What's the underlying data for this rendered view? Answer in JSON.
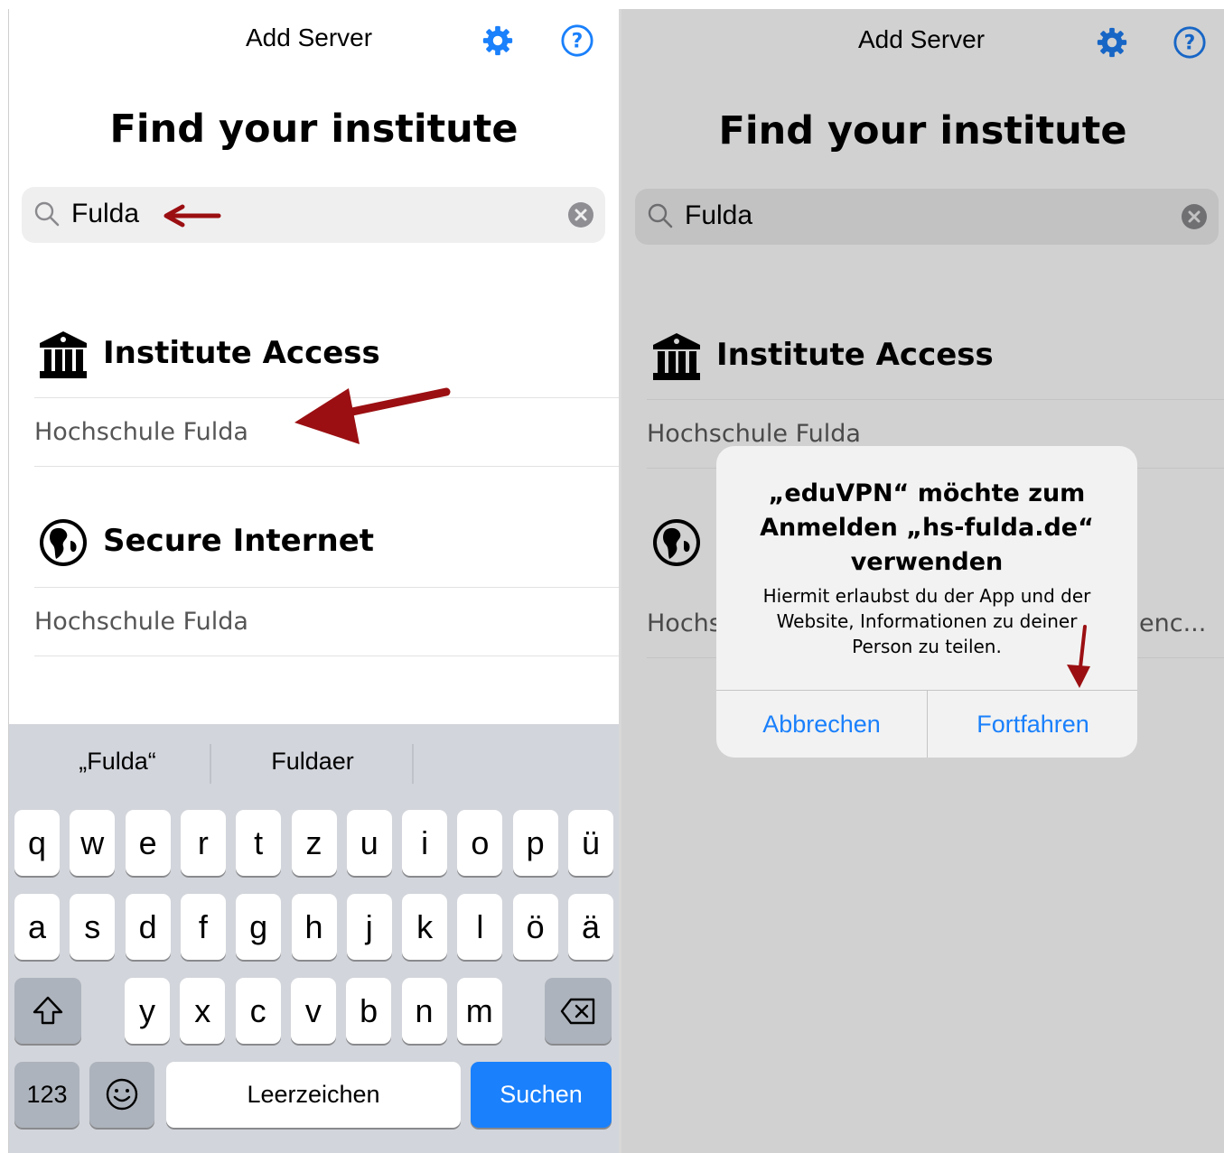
{
  "left": {
    "nav_title": "Add Server",
    "page_title": "Find your institute",
    "search_value": "Fulda",
    "sections": [
      {
        "title": "Institute Access",
        "icon": "institution-icon",
        "item": "Hochschule Fulda"
      },
      {
        "title": "Secure Internet",
        "icon": "globe-icon",
        "item": "Hochschule Fulda"
      }
    ],
    "keyboard": {
      "suggestions": [
        "„Fulda“",
        "Fuldaer"
      ],
      "row1": [
        "q",
        "w",
        "e",
        "r",
        "t",
        "z",
        "u",
        "i",
        "o",
        "p",
        "ü"
      ],
      "row2": [
        "a",
        "s",
        "d",
        "f",
        "g",
        "h",
        "j",
        "k",
        "l",
        "ö",
        "ä"
      ],
      "row3": [
        "y",
        "x",
        "c",
        "v",
        "b",
        "n",
        "m"
      ],
      "numbers_key": "123",
      "space_key": "Leerzeichen",
      "search_key": "Suchen"
    }
  },
  "right": {
    "nav_title": "Add Server",
    "page_title": "Find your institute",
    "search_value": "Fulda",
    "sections": [
      {
        "title": "Institute Access",
        "item": "Hochschule Fulda"
      }
    ],
    "partial_row_left": "Hochs",
    "partial_row_right": "enc...",
    "dialog": {
      "title": "„eduVPN“ möchte zum Anmelden „hs-fulda.de“ verwenden",
      "message": "Hiermit erlaubst du der App und der Website, Informationen zu deiner Person zu teilen.",
      "cancel": "Abbrechen",
      "continue": "Fortfahren"
    }
  },
  "colors": {
    "accent": "#1a80fb",
    "annotation_arrow": "#9b0f12",
    "dim_background": "#d1d1d1"
  }
}
